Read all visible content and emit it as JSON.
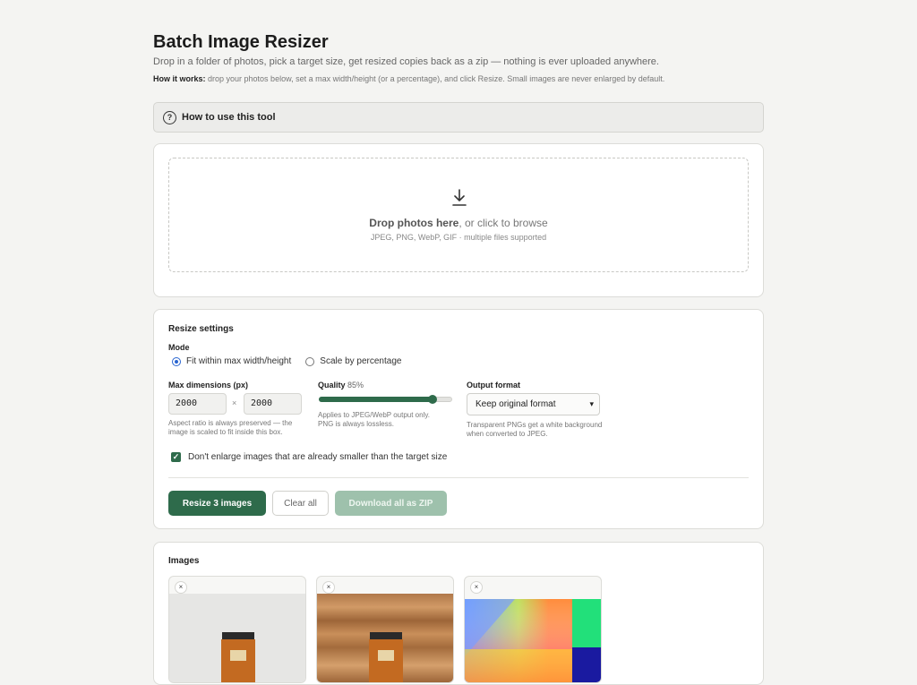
{
  "header": {
    "title": "Batch Image Resizer",
    "subtitle": "Drop in a folder of photos, pick a target size, get resized copies back as a zip — nothing is ever uploaded anywhere.",
    "how_label": "How it works:",
    "how_text": " drop your photos below, set a max width/height (or a percentage), and click Resize. Small images are never enlarged by default."
  },
  "guide": {
    "label": "How to use this tool",
    "icon": "question-circle-icon"
  },
  "dropzone": {
    "icon": "download-arrow-icon",
    "main_bold": "Drop photos here",
    "main_rest": ", or click to browse",
    "sub": "JPEG, PNG, WebP, GIF · multiple files supported"
  },
  "settings": {
    "title": "Resize settings",
    "mode_label": "Mode",
    "mode_options": [
      "Fit within max width/height",
      "Scale by percentage"
    ],
    "mode_selected": 0,
    "max_dims_label": "Max dimensions (px)",
    "width_value": "2000",
    "height_value": "2000",
    "times": "×",
    "max_dims_help": "Aspect ratio is always preserved — the image is scaled to fit inside this box.",
    "quality_label": "Quality",
    "quality_value_text": "85%",
    "quality_fraction": 0.85,
    "quality_help": "Applies to JPEG/WebP output only. PNG is always lossless.",
    "format_label": "Output format",
    "format_selected": "Keep original format",
    "format_help": "Transparent PNGs get a white background when converted to JPEG.",
    "no_enlarge_label": "Don't enlarge images that are already smaller than the target size",
    "no_enlarge_checked": true
  },
  "actions": {
    "resize_label": "Resize 3 images",
    "clear_label": "Clear all",
    "zip_label": "Download all as ZIP"
  },
  "images": {
    "title": "Images",
    "close_glyph": "×"
  },
  "colors": {
    "accent": "#2e6b4b",
    "radio": "#2864d0",
    "background": "#f4f4f2"
  }
}
